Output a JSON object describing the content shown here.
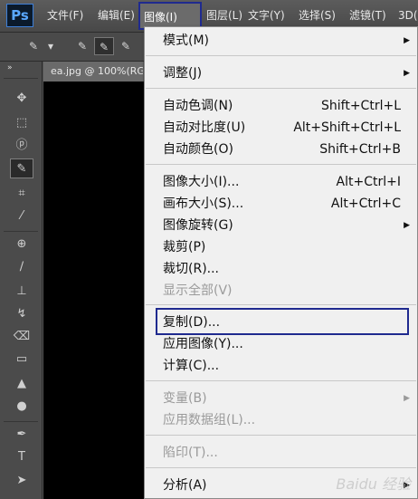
{
  "app": {
    "logo": "Ps"
  },
  "menubar": {
    "items": [
      "文件(F)",
      "编辑(E)",
      "图像(I)",
      "图层(L)",
      "文字(Y)",
      "选择(S)",
      "滤镜(T)",
      "3D("
    ]
  },
  "document": {
    "tab_label": "ea.jpg @ 100%(RG"
  },
  "image_menu": {
    "items": [
      {
        "label": "模式(M)",
        "shortcut": "",
        "submenu": true,
        "enabled": true
      },
      {
        "label": "调整(J)",
        "shortcut": "",
        "submenu": true,
        "enabled": true
      },
      {
        "label": "自动色调(N)",
        "shortcut": "Shift+Ctrl+L",
        "submenu": false,
        "enabled": true
      },
      {
        "label": "自动对比度(U)",
        "shortcut": "Alt+Shift+Ctrl+L",
        "submenu": false,
        "enabled": true
      },
      {
        "label": "自动颜色(O)",
        "shortcut": "Shift+Ctrl+B",
        "submenu": false,
        "enabled": true
      },
      {
        "label": "图像大小(I)...",
        "shortcut": "Alt+Ctrl+I",
        "submenu": false,
        "enabled": true
      },
      {
        "label": "画布大小(S)...",
        "shortcut": "Alt+Ctrl+C",
        "submenu": false,
        "enabled": true
      },
      {
        "label": "图像旋转(G)",
        "shortcut": "",
        "submenu": true,
        "enabled": true
      },
      {
        "label": "裁剪(P)",
        "shortcut": "",
        "submenu": false,
        "enabled": true
      },
      {
        "label": "裁切(R)...",
        "shortcut": "",
        "submenu": false,
        "enabled": true
      },
      {
        "label": "显示全部(V)",
        "shortcut": "",
        "submenu": false,
        "enabled": false
      },
      {
        "label": "复制(D)...",
        "shortcut": "",
        "submenu": false,
        "enabled": true
      },
      {
        "label": "应用图像(Y)...",
        "shortcut": "",
        "submenu": false,
        "enabled": true
      },
      {
        "label": "计算(C)...",
        "shortcut": "",
        "submenu": false,
        "enabled": true
      },
      {
        "label": "变量(B)",
        "shortcut": "",
        "submenu": true,
        "enabled": false
      },
      {
        "label": "应用数据组(L)...",
        "shortcut": "",
        "submenu": false,
        "enabled": false
      },
      {
        "label": "陷印(T)...",
        "shortcut": "",
        "submenu": false,
        "enabled": false
      },
      {
        "label": "分析(A)",
        "shortcut": "",
        "submenu": true,
        "enabled": true
      }
    ]
  },
  "watermark": "Baidu 经验",
  "icons": {
    "submenu_arrow": "▶",
    "tools": [
      "move-icon",
      "marquee-icon",
      "lasso-icon",
      "quick-select-icon",
      "crop-icon",
      "eyedropper-icon",
      "healing-icon",
      "brush-icon",
      "stamp-icon",
      "history-brush-icon",
      "eraser-icon",
      "gradient-icon",
      "blur-icon",
      "dodge-icon",
      "pen-icon",
      "type-icon",
      "path-select-icon"
    ]
  },
  "colors": {
    "highlight_outline": "#1f2a8f",
    "menu_bg": "#f0f0f0",
    "disabled_text": "#9a9a9a"
  }
}
